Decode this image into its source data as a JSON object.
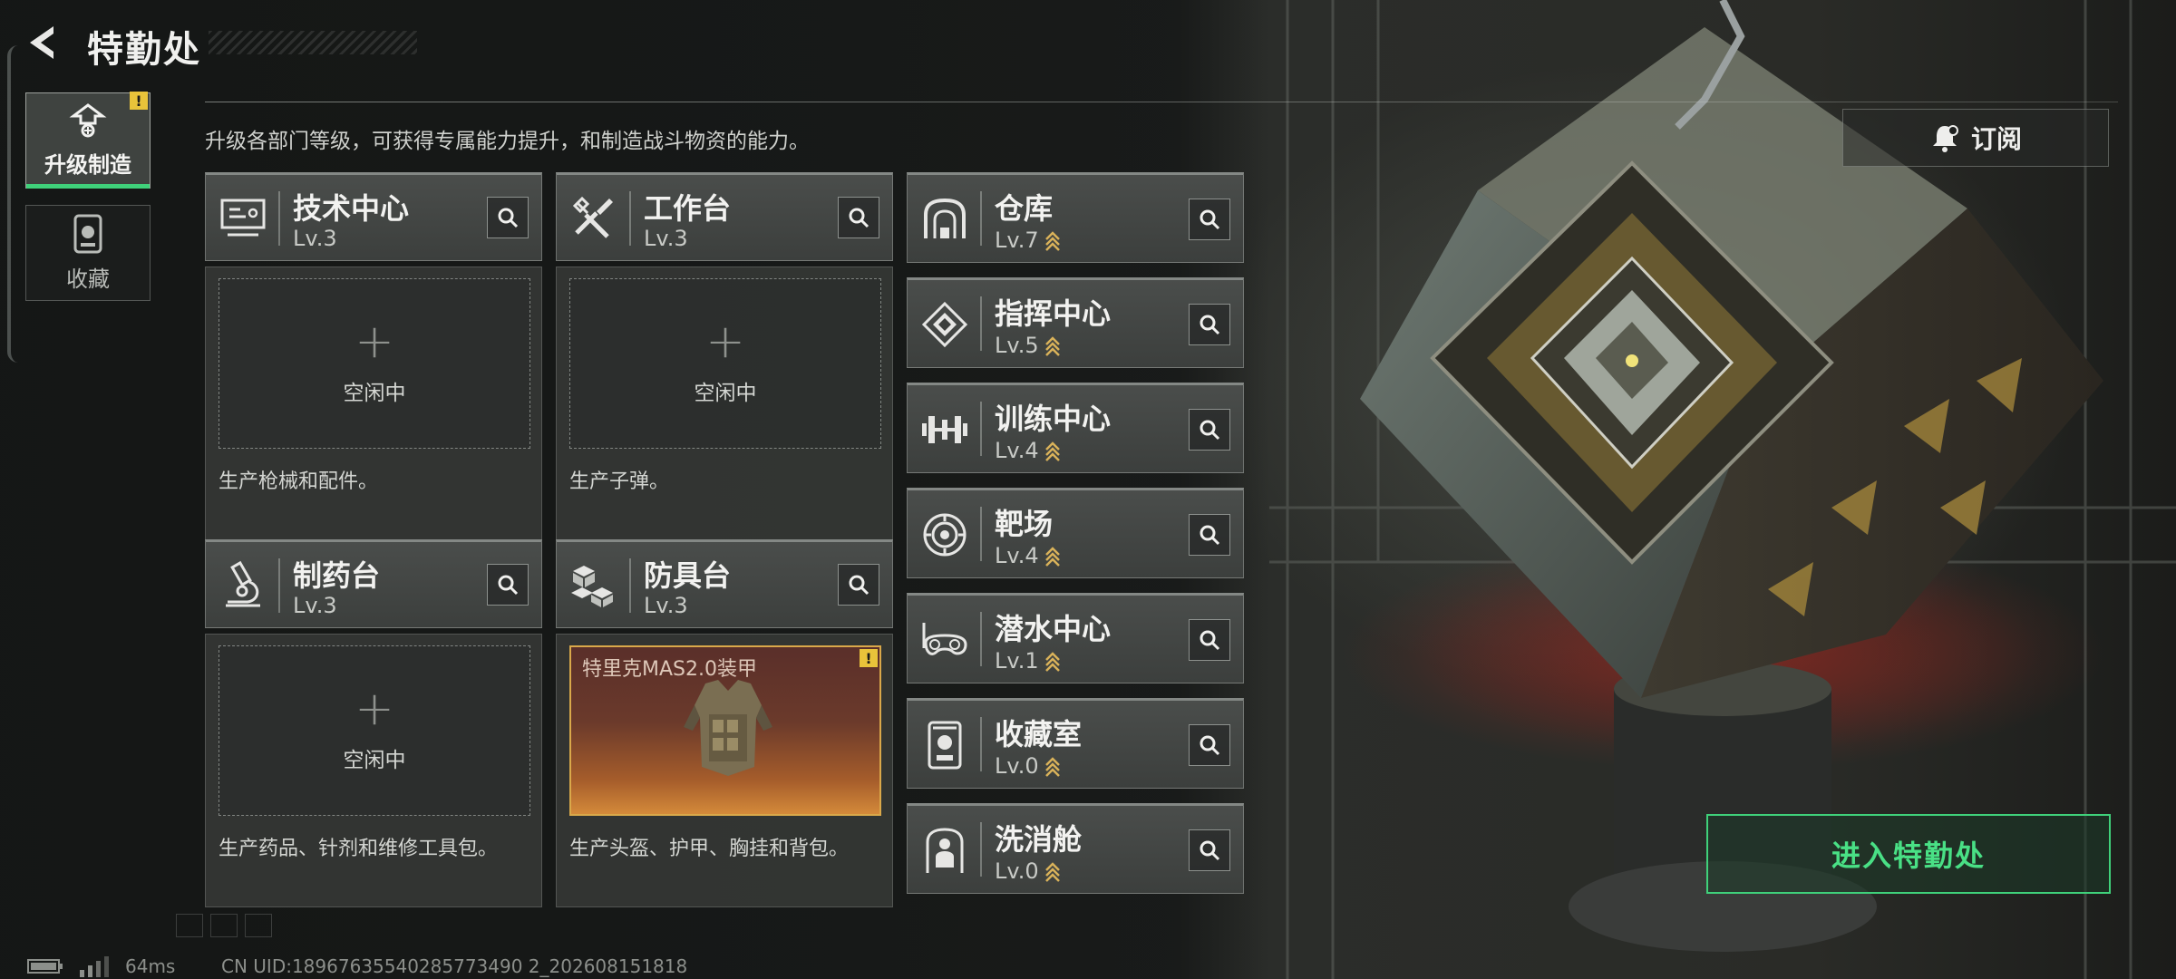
{
  "header": {
    "title": "特勤处",
    "back_icon": "back-arrow-icon"
  },
  "nav": {
    "items": [
      {
        "label": "升级制造",
        "icon": "upgrade-icon",
        "active": true,
        "badge": "!"
      },
      {
        "label": "收藏",
        "icon": "collection-icon",
        "active": false
      }
    ]
  },
  "description": "升级各部门等级，可获得专属能力提升，和制造战斗物资的能力。",
  "subscribe": {
    "label": "订阅",
    "icon": "bell-icon"
  },
  "production": [
    {
      "name": "技术中心",
      "level": "Lv.3",
      "icon": "monitor-icon",
      "slot_status": "空闲中",
      "desc": "生产枪械和配件。"
    },
    {
      "name": "工作台",
      "level": "Lv.3",
      "icon": "tools-icon",
      "slot_status": "空闲中",
      "desc": "生产子弹。"
    },
    {
      "name": "制药台",
      "level": "Lv.3",
      "icon": "microscope-icon",
      "slot_status": "空闲中",
      "desc": "生产药品、针剂和维修工具包。"
    },
    {
      "name": "防具台",
      "level": "Lv.3",
      "icon": "boxes-icon",
      "slot_item": "特里克MAS2.0装甲",
      "slot_badge": "!",
      "desc": "生产头盔、护甲、胸挂和背包。"
    }
  ],
  "departments": [
    {
      "name": "仓库",
      "level": "Lv.7",
      "icon": "warehouse-icon"
    },
    {
      "name": "指挥中心",
      "level": "Lv.5",
      "icon": "command-icon"
    },
    {
      "name": "训练中心",
      "level": "Lv.4",
      "icon": "dumbbell-icon"
    },
    {
      "name": "靶场",
      "level": "Lv.4",
      "icon": "target-icon"
    },
    {
      "name": "潜水中心",
      "level": "Lv.1",
      "icon": "diving-goggles-icon"
    },
    {
      "name": "收藏室",
      "level": "Lv.0",
      "icon": "display-case-icon"
    },
    {
      "name": "洗消舱",
      "level": "Lv.0",
      "icon": "decontamination-icon"
    }
  ],
  "enter": {
    "label": "进入特勤处"
  },
  "status": {
    "ping": "64ms",
    "uid": "CN UID:18967635540285773490 2_202608151818"
  },
  "colors": {
    "accent_green": "#3fd17a",
    "alert_yellow": "#e8c33a",
    "level_up": "#d9b25a"
  }
}
